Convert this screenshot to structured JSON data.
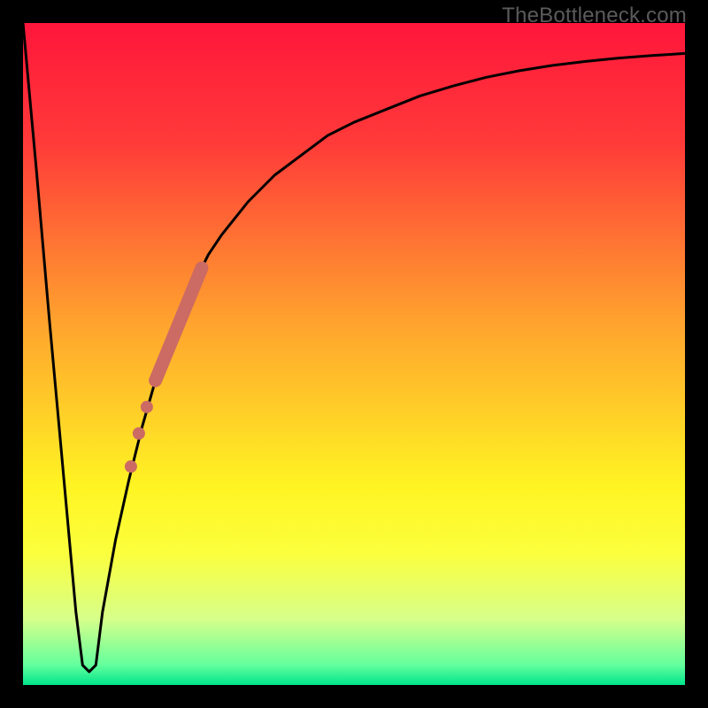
{
  "watermark": "TheBottleneck.com",
  "gradient": {
    "stops": [
      {
        "pct": 0,
        "color": "#ff163b"
      },
      {
        "pct": 18,
        "color": "#ff3a39"
      },
      {
        "pct": 45,
        "color": "#ffa22e"
      },
      {
        "pct": 70,
        "color": "#fff423"
      },
      {
        "pct": 80,
        "color": "#fbff3c"
      },
      {
        "pct": 90,
        "color": "#d7ff8a"
      },
      {
        "pct": 97,
        "color": "#63ff9d"
      },
      {
        "pct": 100,
        "color": "#00e58b"
      }
    ]
  },
  "curve_color": "#000000",
  "marker_color": "#cc6b63",
  "chart_data": {
    "type": "line",
    "title": "",
    "xlabel": "",
    "ylabel": "",
    "xlim": [
      0,
      100
    ],
    "ylim": [
      0,
      100
    ],
    "series": [
      {
        "name": "bottleneck-curve",
        "x": [
          0,
          2,
          4,
          6,
          8,
          9,
          10,
          11,
          12,
          14,
          16,
          18,
          20,
          22,
          24,
          26,
          28,
          30,
          34,
          38,
          42,
          46,
          50,
          55,
          60,
          65,
          70,
          75,
          80,
          85,
          90,
          95,
          100
        ],
        "y": [
          100,
          78,
          55,
          33,
          11,
          3,
          2,
          3,
          11,
          22,
          31,
          39,
          46,
          52,
          57,
          61,
          65,
          68,
          73,
          77,
          80,
          83,
          85,
          87,
          89,
          90.5,
          91.8,
          92.8,
          93.6,
          94.2,
          94.7,
          95.1,
          95.4
        ]
      }
    ],
    "markers": {
      "name": "highlight-segment",
      "type": "thick-segment-and-dots",
      "segment": {
        "x": [
          20,
          27
        ],
        "y": [
          46,
          63
        ]
      },
      "dots": [
        {
          "x": 18.7,
          "y": 42
        },
        {
          "x": 17.5,
          "y": 38
        },
        {
          "x": 16.3,
          "y": 33
        }
      ]
    }
  }
}
